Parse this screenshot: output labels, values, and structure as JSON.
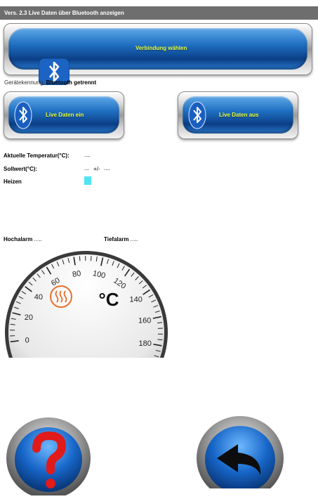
{
  "window": {
    "title": "Vers. 2.3 Live Daten über Bluetooth anzeigen"
  },
  "connect_button": {
    "label": "Verbindung wählen"
  },
  "device": {
    "label": "Gerätekennung:",
    "status": "Bluetooth getrennt"
  },
  "live_on_button": {
    "label": "Live Daten ein"
  },
  "live_off_button": {
    "label": "Live Daten aus"
  },
  "readings": {
    "current_temp_label": "Aktuelle Temperatur(°C):",
    "current_temp_value": "....",
    "setpoint_label": "Sollwert(°C):",
    "setpoint_value": "...",
    "tolerance_sep": "+/-",
    "tolerance_value": "....",
    "heating_label": "Heizen",
    "heating_color": "#4fe4f2"
  },
  "alarms": {
    "high_label": "Hochalarm",
    "high_value": ".....",
    "low_label": "Tiefalarm",
    "low_value": "....."
  },
  "gauge": {
    "unit": "°C",
    "tick_labels": [
      "0",
      "20",
      "40",
      "60",
      "80",
      "100",
      "120",
      "140",
      "160",
      "180"
    ],
    "heating_icon": "heat-waves-icon"
  },
  "bottom": {
    "help_icon": "question-mark-icon",
    "back_icon": "back-arrow-icon"
  },
  "colors": {
    "accent_yellow": "#e8ff3c",
    "button_blue": "#1f6fc2",
    "heat_orange": "#e8702a"
  }
}
